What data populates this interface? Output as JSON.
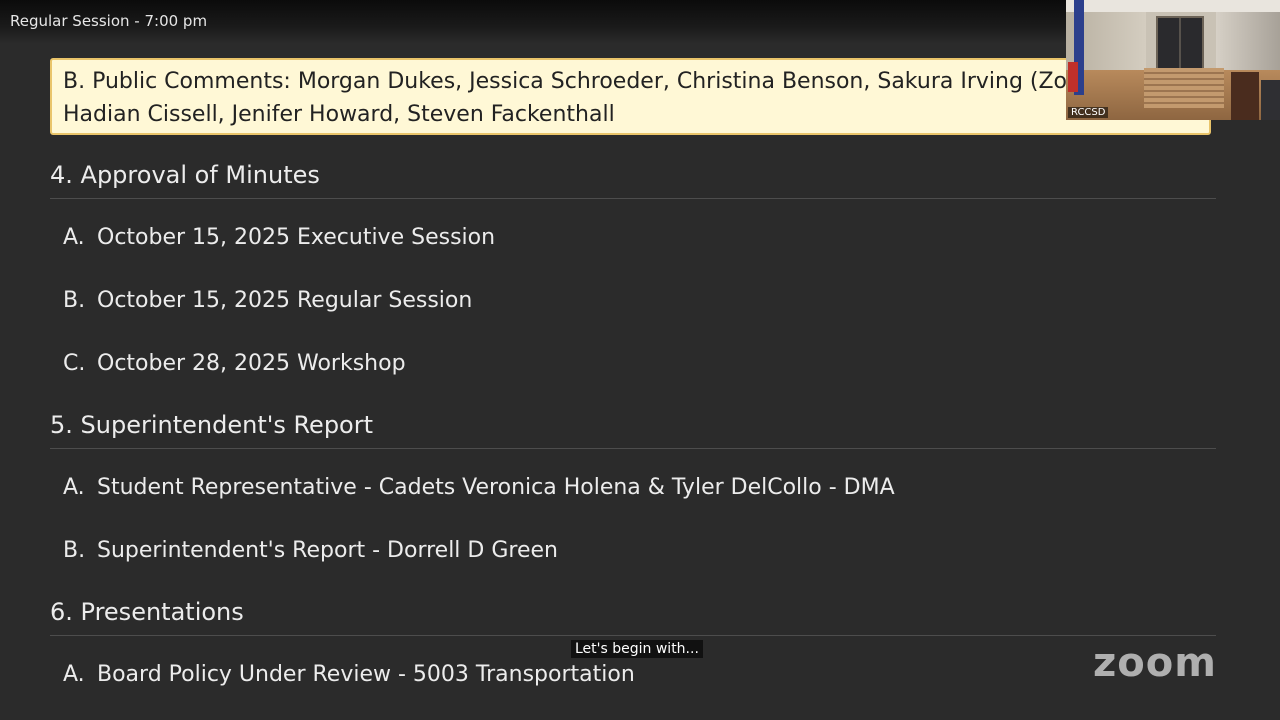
{
  "header": {
    "session_title": "Regular Session - 7:00 pm"
  },
  "highlighted_item": {
    "line1": "B.  Public Comments: Morgan Dukes, Jessica Schroeder, Christina Benson, Sakura Irving (Zo",
    "line2": "Hadian Cissell, Jenifer Howard, Steven Fackenthall"
  },
  "sections": [
    {
      "heading": "4. Approval of Minutes",
      "items": [
        {
          "letter": "A.",
          "text": "October 15, 2025 Executive Session"
        },
        {
          "letter": "B.",
          "text": "October 15, 2025 Regular Session"
        },
        {
          "letter": "C.",
          "text": "October 28, 2025 Workshop"
        }
      ]
    },
    {
      "heading": "5. Superintendent's Report",
      "items": [
        {
          "letter": "A.",
          "text": "Student Representative - Cadets Veronica Holena & Tyler DelCollo - DMA"
        },
        {
          "letter": "B.",
          "text": "Superintendent's Report - Dorrell D Green"
        }
      ]
    },
    {
      "heading": "6. Presentations",
      "items": [
        {
          "letter": "A.",
          "text": "Board Policy Under Review - 5003 Transportation"
        }
      ]
    }
  ],
  "video_thumbnail": {
    "label": "RCCSD"
  },
  "caption": "Let's begin with...",
  "watermark": "zoom"
}
